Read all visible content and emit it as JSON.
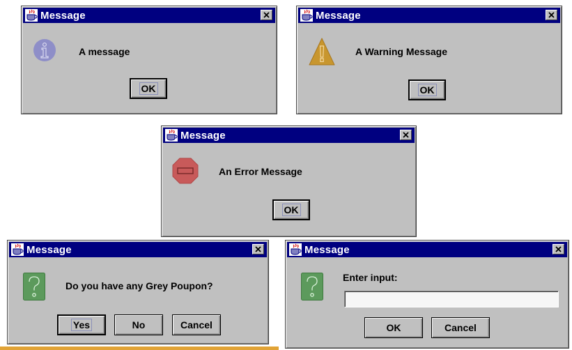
{
  "dialogs": {
    "info": {
      "title": "Message",
      "icon": "info-icon",
      "message": "A message",
      "ok_label": "OK"
    },
    "warning": {
      "title": "Message",
      "icon": "warning-icon",
      "message": "A Warning Message",
      "ok_label": "OK"
    },
    "error": {
      "title": "Message",
      "icon": "error-icon",
      "message": "An Error Message",
      "ok_label": "OK"
    },
    "question": {
      "title": "Message",
      "icon": "question-icon",
      "message": "Do you have any Grey Poupon?",
      "yes_label": "Yes",
      "no_label": "No",
      "cancel_label": "Cancel"
    },
    "input": {
      "title": "Message",
      "icon": "question-icon",
      "prompt": "Enter input:",
      "input_value": "",
      "ok_label": "OK",
      "cancel_label": "Cancel"
    }
  },
  "colors": {
    "dialog_bg": "#c0c0c0",
    "titlebar": "#000080",
    "info": "#8e8ec8",
    "warning": "#c8962e",
    "error": "#c85a5a",
    "question": "#5c9a5c",
    "accent": "#e1a336"
  }
}
